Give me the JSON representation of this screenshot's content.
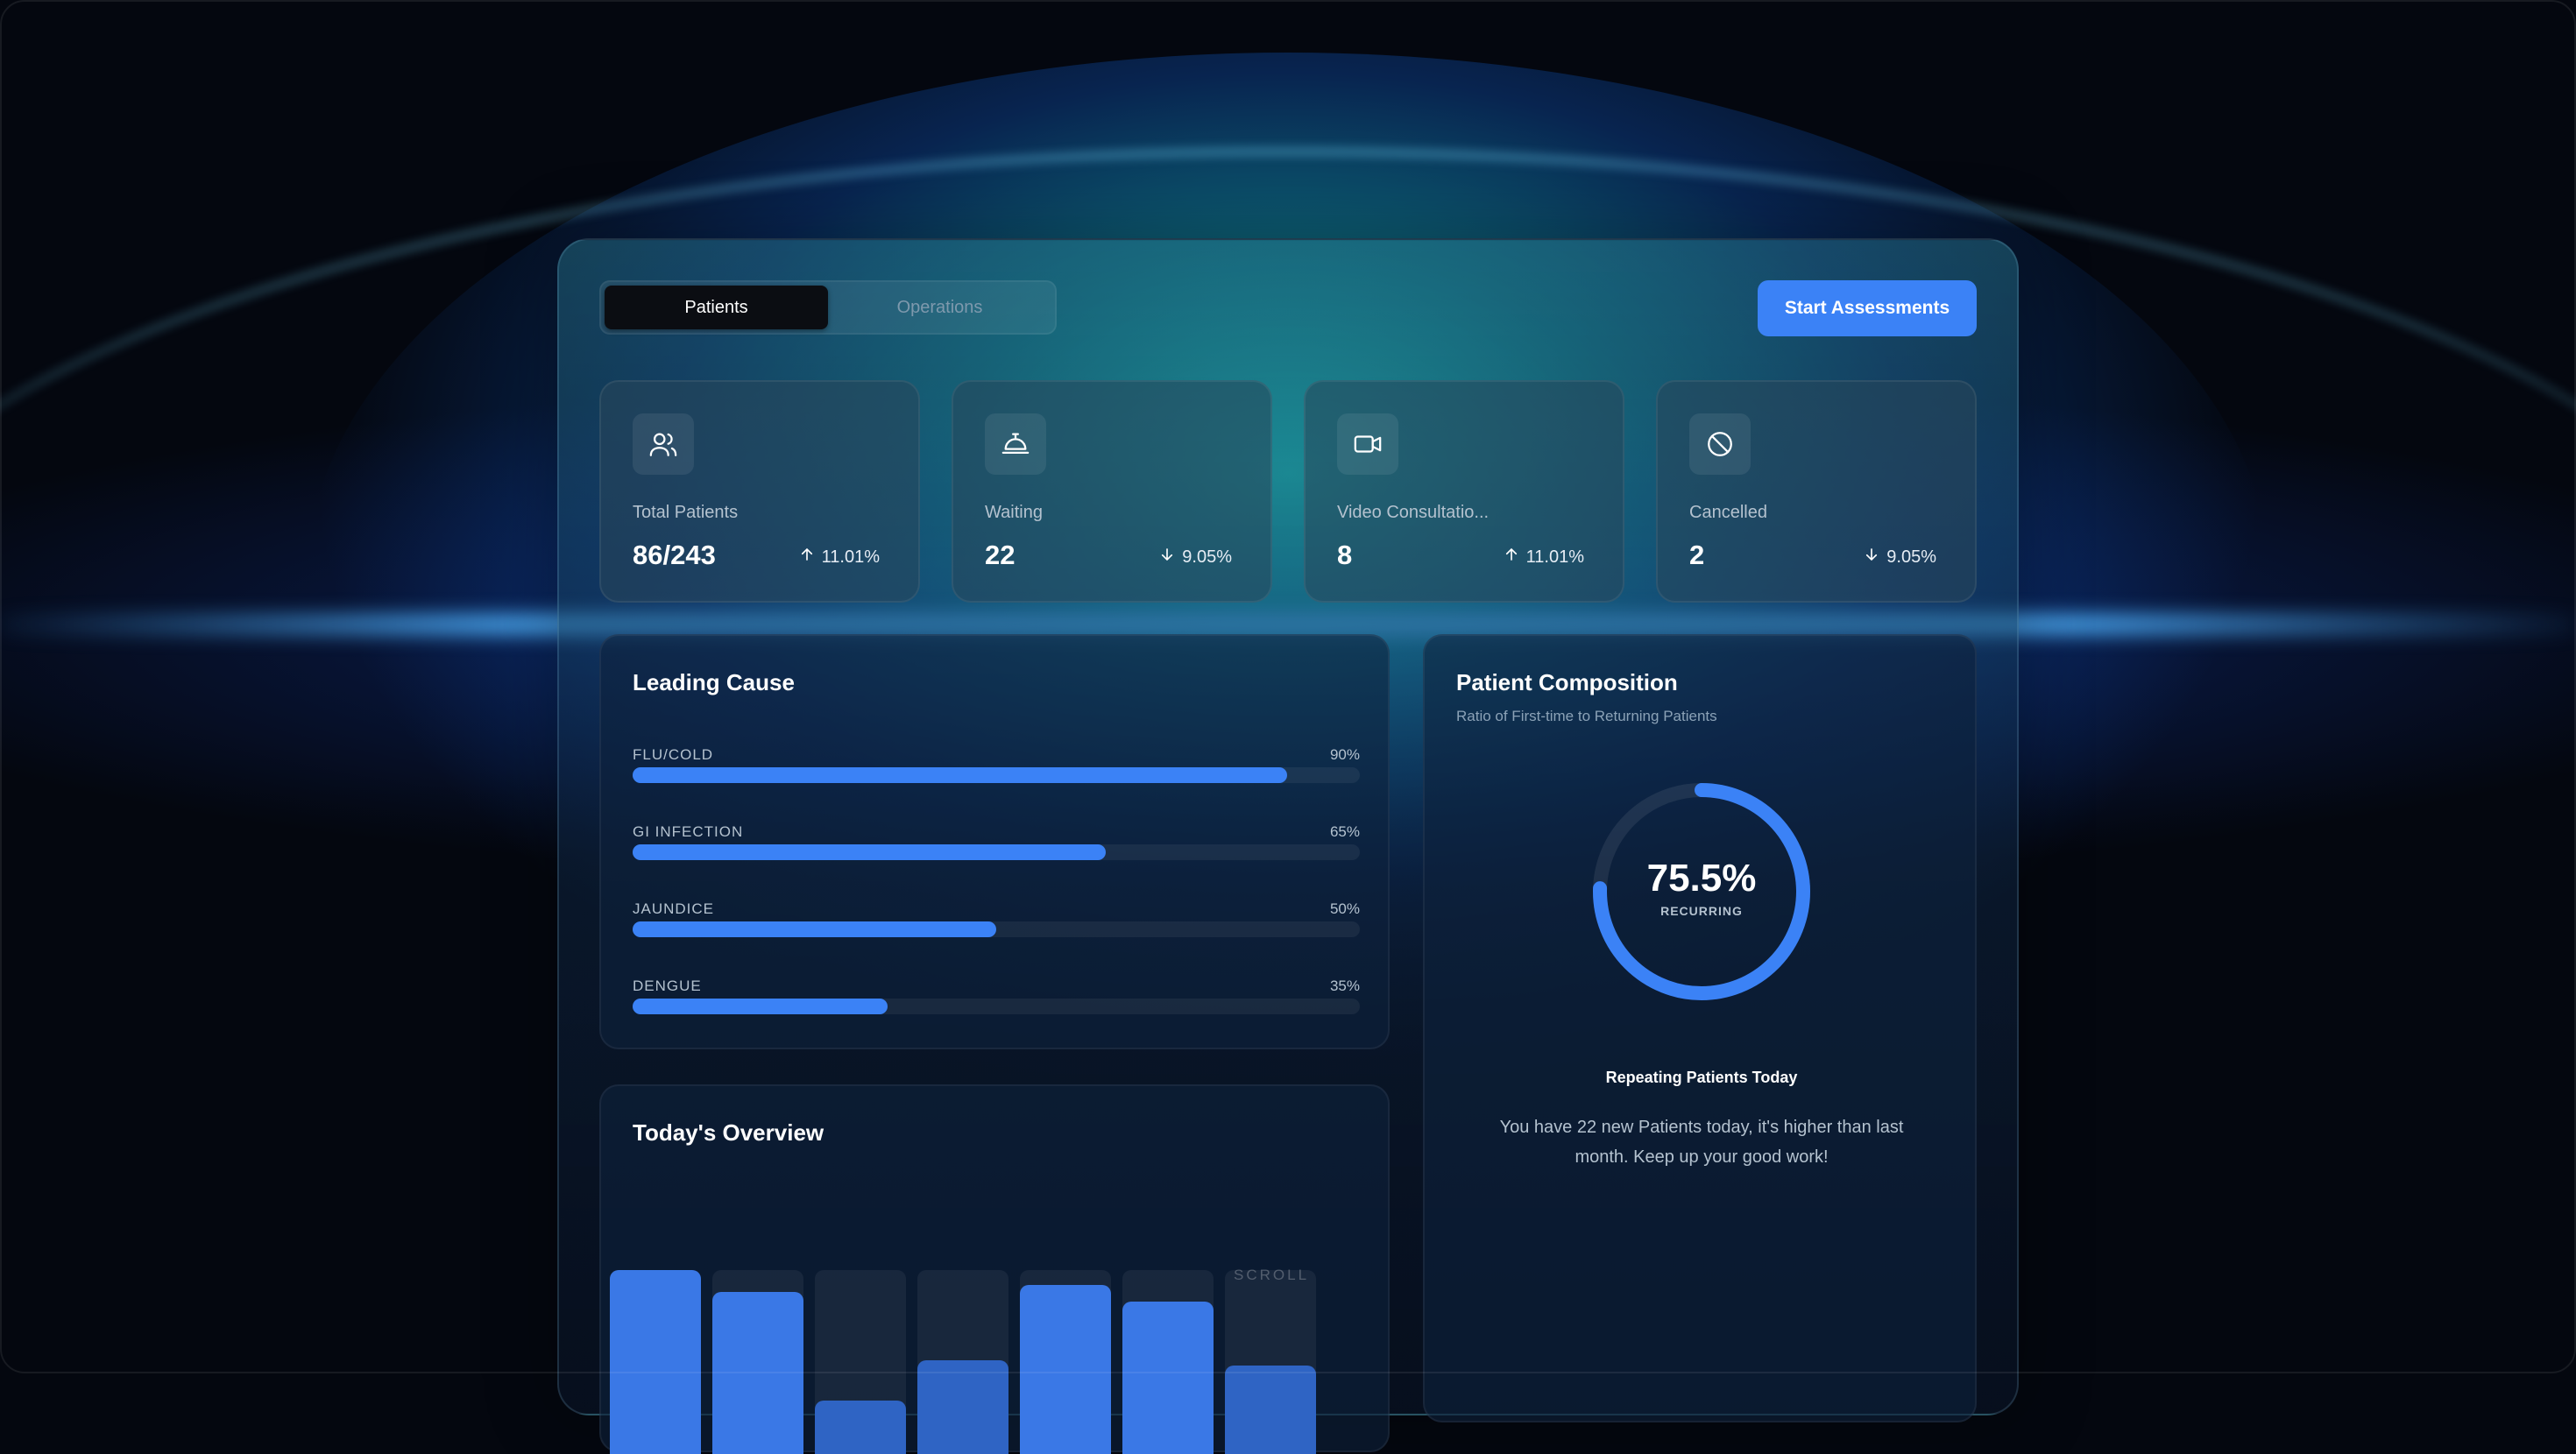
{
  "tabs": [
    {
      "label": "Patients",
      "active": true
    },
    {
      "label": "Operations",
      "active": false
    }
  ],
  "primary_action": {
    "label": "Start Assessments",
    "color": "#3b82f6"
  },
  "stats": [
    {
      "icon": "users-icon",
      "label": "Total Patients",
      "value": "86/243",
      "change": "11.01%",
      "direction": "up"
    },
    {
      "icon": "bell-icon",
      "label": "Waiting",
      "value": "22",
      "change": "9.05%",
      "direction": "down"
    },
    {
      "icon": "video-icon",
      "label": "Video Consultatio...",
      "value": "8",
      "change": "11.01%",
      "direction": "up"
    },
    {
      "icon": "ban-icon",
      "label": "Cancelled",
      "value": "2",
      "change": "9.05%",
      "direction": "down"
    }
  ],
  "leading_cause": {
    "title": "Leading Cause",
    "items": [
      {
        "name": "FLU/COLD",
        "value_label": "90%",
        "value": 90
      },
      {
        "name": "GI INFECTION",
        "value_label": "65%",
        "value": 65
      },
      {
        "name": "JAUNDICE",
        "value_label": "50%",
        "value": 50
      },
      {
        "name": "DENGUE",
        "value_label": "35%",
        "value": 35
      }
    ]
  },
  "composition": {
    "title": "Patient Composition",
    "subtitle": "Ratio of First-time to Returning Patients",
    "percent_label": "75.5%",
    "percent": 75.5,
    "center_label": "RECURRING",
    "headline": "Repeating Patients Today",
    "text": "You have 22 new Patients today, it's higher than last month. Keep up your good work!"
  },
  "overview": {
    "title": "Today's Overview",
    "scroll_hint": "SCROLL",
    "bar_levels": [
      1.0,
      0.88,
      0.29,
      0.51,
      0.92,
      0.83,
      0.48
    ]
  },
  "colors": {
    "accent": "#3b82f6",
    "glow": "#1fd1c8"
  }
}
